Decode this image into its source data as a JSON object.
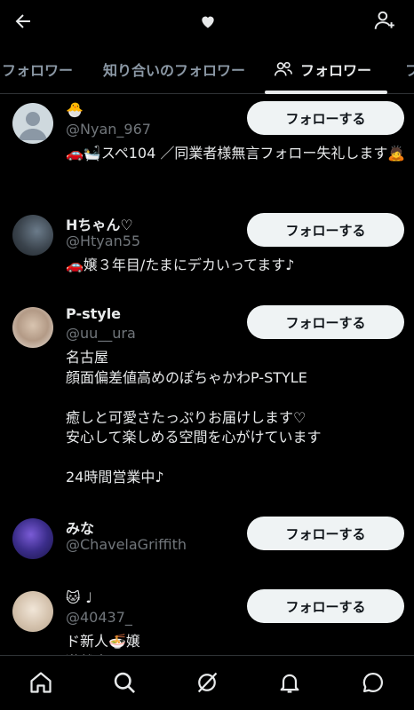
{
  "tabs": [
    {
      "label": "フォロワー"
    },
    {
      "label": "知り合いのフォロワー"
    },
    {
      "label": "フォロワー"
    },
    {
      "label": "フ"
    }
  ],
  "follow_label": "フォローする",
  "users": [
    {
      "name": "🐣",
      "handle": "@Nyan_967",
      "bio": "🚗🛀スペ104 ／同業者様無言フォロー失礼します🙇"
    },
    {
      "name": "Hちゃん♡",
      "handle": "@Htyan55",
      "bio": "🚗嬢３年目/たまにデカいってます♪"
    },
    {
      "name": "P-style",
      "handle": "@uu__ura",
      "bio": "名古屋\n顔面偏差値高めのぽちゃかわP-STYLE\n\n癒しと可愛さたっぷりお届けします♡\n安心して楽しめる空間を心がけています\n\n24時間営業中♪"
    },
    {
      "name": "みな",
      "handle": "@ChavelaGriffith",
      "bio": ""
    },
    {
      "name": "🐱 ♩",
      "handle": "@40437_",
      "bio": "ド新人🍜嬢\n激離出"
    }
  ],
  "colors": {
    "background": "#000000",
    "button_bg": "#eff3f4",
    "muted": "#71767b",
    "text": "#e7e9ea"
  },
  "icons": [
    "back-arrow-icon",
    "heart-icon",
    "add-user-icon",
    "people-icon",
    "home-icon",
    "search-icon",
    "grok-icon",
    "bell-icon",
    "message-icon"
  ]
}
